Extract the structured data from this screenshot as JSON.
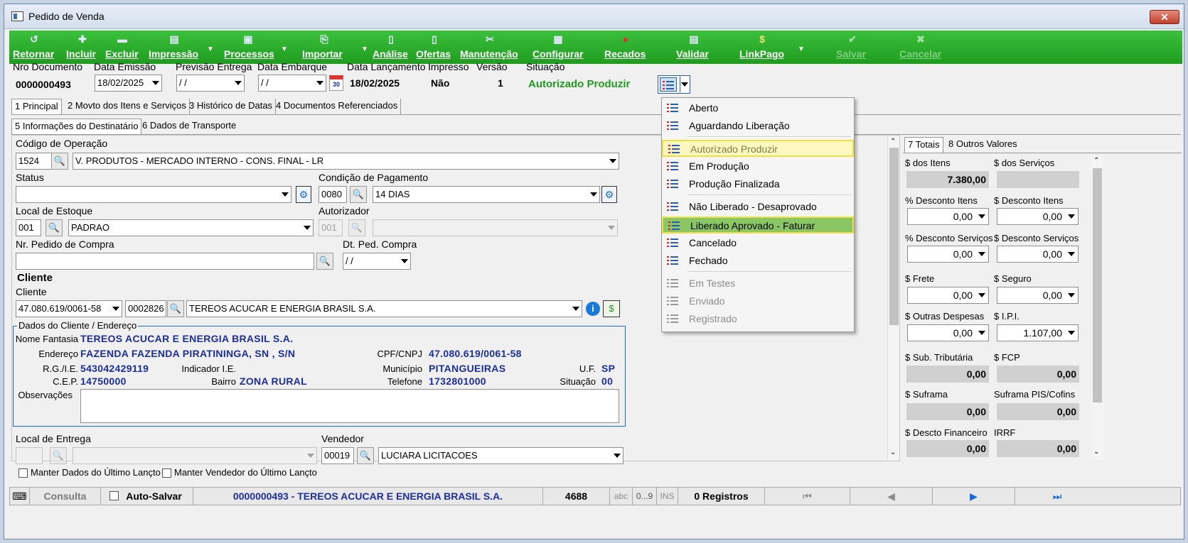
{
  "window": {
    "title": "Pedido de Venda",
    "close_label": "✕"
  },
  "toolbar": {
    "buttons": [
      {
        "label": "Retornar",
        "icon": "return-icon"
      },
      {
        "label": "Incluir",
        "icon": "add-icon"
      },
      {
        "label": "Excluir",
        "icon": "delete-icon"
      },
      {
        "label": "Impressão",
        "icon": "print-icon"
      },
      {
        "label": "Processos",
        "icon": "process-icon"
      },
      {
        "label": "Importar",
        "icon": "import-icon"
      },
      {
        "label": "Análise",
        "icon": "analysis-icon"
      },
      {
        "label": "Ofertas",
        "icon": "offers-icon"
      },
      {
        "label": "Manutenção",
        "icon": "maintenance-icon"
      },
      {
        "label": "Configurar",
        "icon": "configure-icon"
      },
      {
        "label": "Recados",
        "icon": "messages-icon"
      },
      {
        "label": "Validar",
        "icon": "validate-icon"
      },
      {
        "label": "LinkPago",
        "icon": "linkpago-icon"
      },
      {
        "label": "Salvar",
        "icon": "save-icon"
      },
      {
        "label": "Cancelar",
        "icon": "cancel-icon"
      }
    ]
  },
  "header": {
    "nro_documento": {
      "label": "Nro Documento",
      "value": "0000000493"
    },
    "data_emissao": {
      "label": "Data Emissão",
      "value": "18/02/2025"
    },
    "previsao_entrega": {
      "label": "Previsão Entrega",
      "value": " / /"
    },
    "data_embarque": {
      "label": "Data Embarque",
      "value": " / /"
    },
    "calendar_icon_text": "30",
    "data_lancamento": {
      "label": "Data Lançamento",
      "value": "18/02/2025"
    },
    "impresso": {
      "label": "Impresso",
      "value": "Não"
    },
    "versao": {
      "label": "Versão",
      "value": "1"
    },
    "situacao": {
      "label": "Situação",
      "value": "Autorizado Produzir",
      "color": "#1f9c1f"
    }
  },
  "tabs_main": [
    {
      "label": "1 Principal",
      "active": true
    },
    {
      "label": "2 Movto dos Itens e Serviços"
    },
    {
      "label": "3 Histórico de Datas"
    },
    {
      "label": "4 Documentos Referenciados"
    }
  ],
  "tabs_sub": [
    {
      "label": "5 Informações do Destinatário",
      "active": true
    },
    {
      "label": "6 Dados de Transporte"
    }
  ],
  "form": {
    "codigo_operacao": {
      "label": "Código de Operação",
      "code": "1524",
      "desc": "V. PRODUTOS - MERCADO INTERNO - CONS. FINAL - LR"
    },
    "status": {
      "label": "Status",
      "value": ""
    },
    "condicao_pagamento": {
      "label": "Condição de Pagamento",
      "code": "0080",
      "desc": "14 DIAS"
    },
    "local_estoque": {
      "label": "Local de Estoque",
      "code": "001",
      "desc": "PADRAO"
    },
    "autorizador": {
      "label": "Autorizador",
      "code": "001",
      "desc": ""
    },
    "nr_pedido_compra": {
      "label": "Nr. Pedido de Compra",
      "value": ""
    },
    "dt_ped_compra": {
      "label": "Dt. Ped. Compra",
      "value": " / /"
    },
    "cliente_section": "Cliente",
    "cliente": {
      "label": "Cliente",
      "cnpj": "47.080.619/0061-58",
      "code": "0002826",
      "name": "TEREOS ACUCAR E ENERGIA BRASIL S.A."
    },
    "dados_cliente": {
      "legend": "Dados do Cliente / Endereço",
      "nome_fantasia_label": "Nome Fantasia",
      "nome_fantasia": "TEREOS ACUCAR E ENERGIA BRASIL S.A.",
      "endereco_label": "Endereço",
      "endereco": "FAZENDA FAZENDA PIRATININGA, SN , S/N",
      "cpf_label": "CPF/CNPJ",
      "cpf": "47.080.619/0061-58",
      "rg_label": "R.G./I.E.",
      "rg": "543042429119",
      "indicador_label": "Indicador I.E.",
      "indicador": "",
      "municipio_label": "Município",
      "municipio": "PITANGUEIRAS",
      "uf_label": "U.F.",
      "uf": "SP",
      "cep_label": "C.E.P.",
      "cep": "14750000",
      "bairro_label": "Bairro",
      "bairro": "ZONA RURAL",
      "telefone_label": "Telefone",
      "telefone": "1732801000",
      "situacao_label": "Situação",
      "situacao": "00",
      "observacoes_label": "Observações"
    },
    "local_entrega": {
      "label": "Local de Entrega",
      "code": "",
      "desc": ""
    },
    "vendedor": {
      "label": "Vendedor",
      "code": "00019",
      "name": "LUCIARA LICITACOES"
    },
    "manter_dados": "Manter Dados do Último Lançto",
    "manter_vendedor": "Manter Vendedor do Último Lançto"
  },
  "situacao_menu": {
    "items": [
      {
        "label": "Aberto"
      },
      {
        "label": "Aguardando Liberação"
      },
      {
        "label": "Autorizado Produzir",
        "state": "highlight-yellow"
      },
      {
        "label": "Em Produção"
      },
      {
        "label": "Produção Finalizada"
      },
      {
        "label": "Não Liberado - Desaprovado"
      },
      {
        "label": "Liberado Aprovado - Faturar",
        "state": "highlight-green"
      },
      {
        "label": "Cancelado"
      },
      {
        "label": "Fechado"
      },
      {
        "label": "Em Testes",
        "state": "disabled"
      },
      {
        "label": "Enviado",
        "state": "disabled"
      },
      {
        "label": "Registrado",
        "state": "disabled"
      }
    ]
  },
  "totais": {
    "tabs": [
      {
        "label": "7 Totais",
        "active": true
      },
      {
        "label": "8 Outros Valores"
      }
    ],
    "dos_itens": {
      "label": "$ dos Itens",
      "value": "7.380,00"
    },
    "dos_servicos": {
      "label": "$ dos Serviços",
      "value": ""
    },
    "pct_desc_itens": {
      "label": "% Desconto Itens",
      "value": "0,00"
    },
    "desc_itens": {
      "label": "$ Desconto Itens",
      "value": "0,00"
    },
    "pct_desc_servicos": {
      "label": "% Desconto Serviços",
      "value": "0,00"
    },
    "desc_servicos": {
      "label": "$ Desconto Serviços",
      "value": "0,00"
    },
    "frete": {
      "label": "$ Frete",
      "value": "0,00"
    },
    "seguro": {
      "label": "$ Seguro",
      "value": "0,00"
    },
    "outras_despesas": {
      "label": "$ Outras Despesas",
      "value": "0,00"
    },
    "ipi": {
      "label": "$ I.P.I.",
      "value": "1.107,00"
    },
    "sub_tributaria": {
      "label": "$ Sub. Tributária",
      "value": "0,00"
    },
    "fcp": {
      "label": "$ FCP",
      "value": "0,00"
    },
    "suframa": {
      "label": "$ Suframa",
      "value": "0,00"
    },
    "suframa_pis": {
      "label": "Suframa PIS/Cofins",
      "value": "0,00"
    },
    "descto_financeiro": {
      "label": "$ Descto Financeiro",
      "value": "0,00"
    },
    "irrf": {
      "label": "IRRF",
      "value": "0,00"
    }
  },
  "statusbar": {
    "mode": "Consulta",
    "autosave": "Auto-Salvar",
    "record": "0000000493 - TEREOS ACUCAR E ENERGIA BRASIL S.A.",
    "code": "4688",
    "abc": "abc",
    "num": "0...9",
    "ins": "INS",
    "registros": "0 Registros"
  }
}
